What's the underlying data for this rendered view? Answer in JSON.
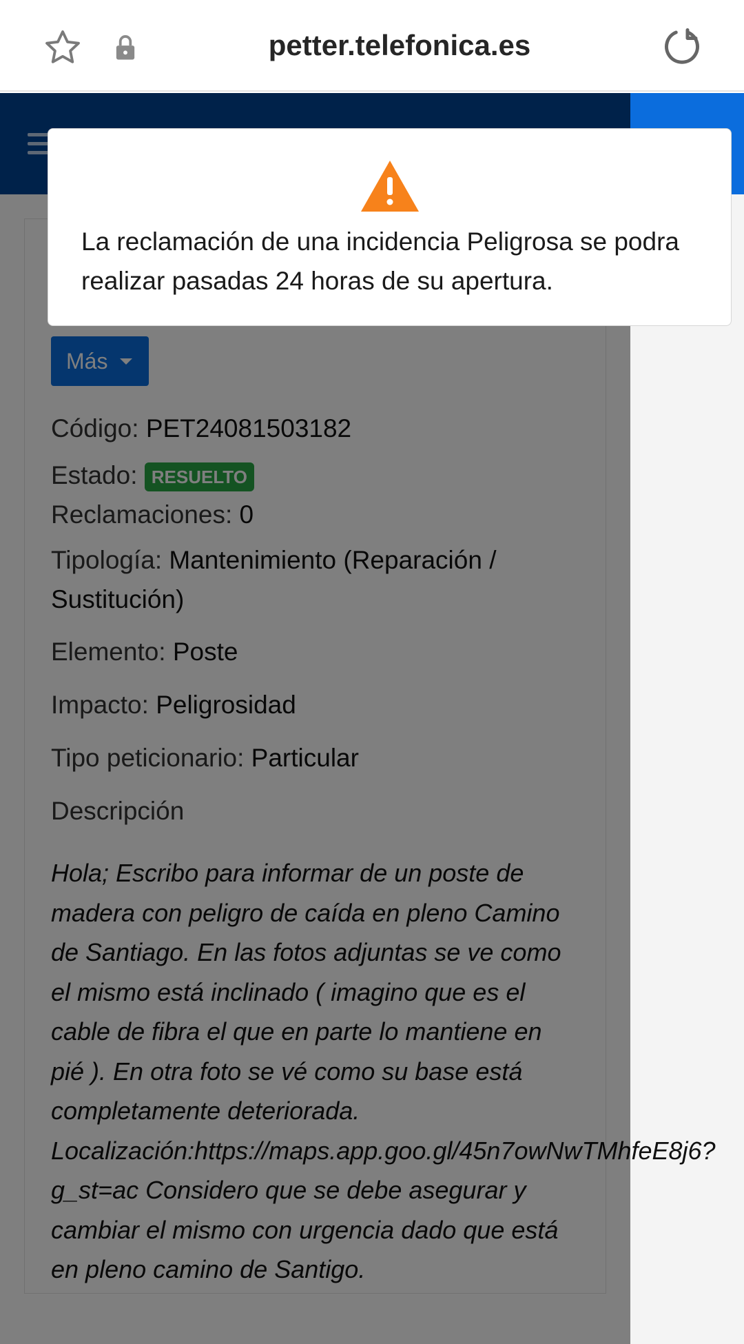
{
  "browser": {
    "url": "petter.telefonica.es",
    "icons": [
      "star-icon",
      "lock-icon",
      "reload-icon"
    ]
  },
  "header": {
    "menu_icon": "hamburger-icon",
    "apps_icon": "dots-icon"
  },
  "modal": {
    "icon": "warning-icon",
    "message": "La reclamación de una incidencia Peligrosa se podra realizar pasadas 24 horas de su apertura."
  },
  "actions": {
    "more_label": "Más"
  },
  "details": {
    "codigo_label": "Código:",
    "codigo_value": "PET24081503182",
    "estado_label": "Estado:",
    "estado_value": "RESUELTO",
    "reclamaciones_label": "Reclamaciones:",
    "reclamaciones_value": "0",
    "tipologia_label": "Tipología:",
    "tipologia_value": "Mantenimiento (Reparación / Sustitución)",
    "elemento_label": "Elemento:",
    "elemento_value": "Poste",
    "impacto_label": "Impacto:",
    "impacto_value": "Peligrosidad",
    "tipo_peticionario_label": "Tipo peticionario:",
    "tipo_peticionario_value": "Particular",
    "descripcion_label": "Descripción",
    "descripcion_value": "Hola; Escribo para informar de un poste de madera con peligro de caída en pleno Camino de Santiago.   En las fotos adjuntas se ve como el mismo está inclinado ( imagino que es el cable de fibra el que en parte lo mantiene en pié ). En otra foto se vé como su base está completamente deteriorada. Localización:https://maps.app.goo.gl/45n7owNwTMhfeE8j6?g_st=ac Considero que se debe asegurar y cambiar el mismo con urgencia dado que está en pleno camino de Santigo."
  },
  "colors": {
    "header_blue": "#004595",
    "accent_blue": "#0b6ddd",
    "badge_green": "#28a745",
    "warning_orange": "#f7821b"
  }
}
